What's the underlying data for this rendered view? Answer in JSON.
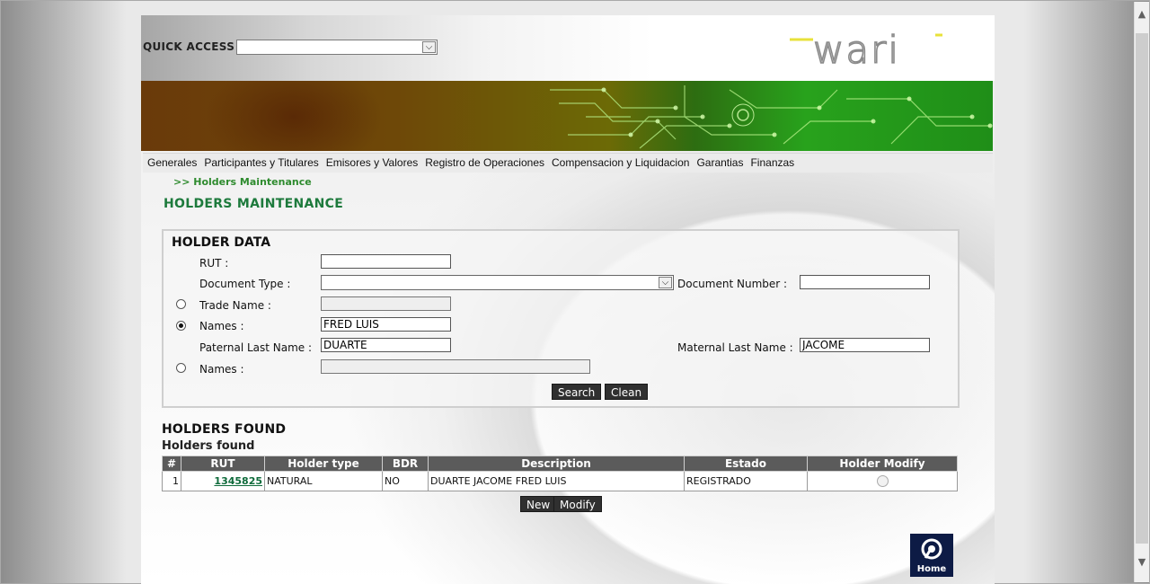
{
  "quick_access": {
    "label": "QUICK ACCESS :",
    "value": ""
  },
  "logo": {
    "text": "wari"
  },
  "nav": {
    "items": [
      "Generales",
      "Participantes y Titulares",
      "Emisores y Valores",
      "Registro de Operaciones",
      "Compensacion y Liquidacion",
      "Garantias",
      "Finanzas"
    ]
  },
  "breadcrumb": ">> Holders Maintenance",
  "page_title": "HOLDERS MAINTENANCE",
  "holder_data": {
    "title": "HOLDER DATA",
    "rut_label": "RUT :",
    "rut_value": "",
    "document_type_label": "Document Type :",
    "document_type_value": "",
    "document_number_label": "Document Number :",
    "document_number_value": "",
    "trade_name_label": "Trade Name :",
    "trade_name_value": "",
    "names_label": "Names :",
    "names_value": "FRED LUIS",
    "paternal_label": "Paternal Last Name :",
    "paternal_value": "DUARTE",
    "maternal_label": "Maternal Last Name :",
    "maternal_value": "JACOME",
    "names2_label": "Names :",
    "names2_value": "",
    "search_btn": "Search",
    "clean_btn": "Clean"
  },
  "holders_found": {
    "title": "HOLDERS FOUND",
    "subtitle": "Holders found",
    "columns": [
      "#",
      "RUT",
      "Holder type",
      "BDR",
      "Description",
      "Estado",
      "Holder Modify"
    ],
    "rows": [
      {
        "num": "1",
        "rut": "1345825",
        "holder_type": "NATURAL",
        "bdr": "NO",
        "description": "DUARTE JACOME FRED LUIS",
        "estado": "REGISTRADO"
      }
    ],
    "new_btn": "New",
    "modify_btn": "Modify"
  },
  "home": {
    "label": "Home"
  },
  "colors": {
    "title_green": "#1d7a3c",
    "button_dark": "#303030",
    "table_header": "#5b5b5b",
    "home_navy": "#0d1b45"
  }
}
